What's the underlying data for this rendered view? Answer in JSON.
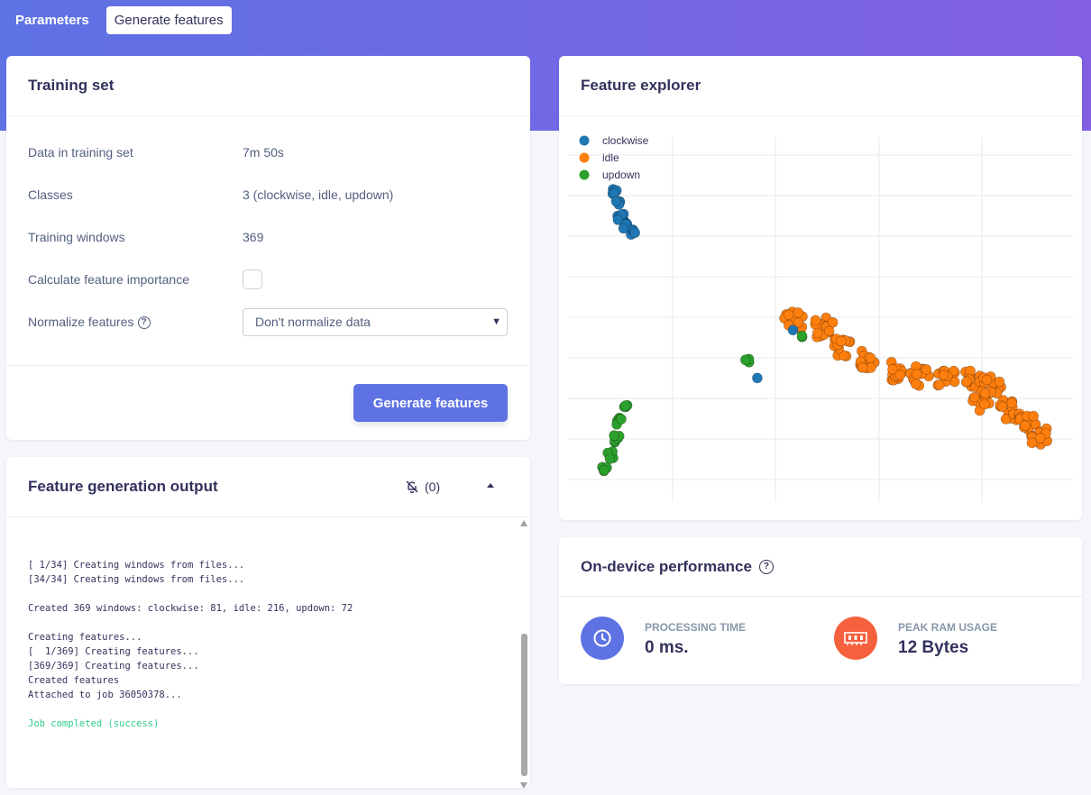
{
  "tabs": [
    {
      "label": "Parameters",
      "active": false
    },
    {
      "label": "Generate features",
      "active": true
    }
  ],
  "training_set": {
    "title": "Training set",
    "rows": [
      {
        "label": "Data in training set",
        "value": "7m 50s"
      },
      {
        "label": "Classes",
        "value": "3 (clockwise, idle, updown)"
      },
      {
        "label": "Training windows",
        "value": "369"
      },
      {
        "label": "Calculate feature importance",
        "checked": false
      },
      {
        "label": "Normalize features",
        "selected": "Don't normalize data"
      }
    ],
    "button": "Generate features"
  },
  "output": {
    "title": "Feature generation output",
    "notifications": "(0)",
    "log_lines": [
      "[ 1/34] Creating windows from files...",
      "[34/34] Creating windows from files...",
      "",
      "Created 369 windows: clockwise: 81, idle: 216, updown: 72",
      "",
      "Creating features...",
      "[  1/369] Creating features...",
      "[369/369] Creating features...",
      "Created features",
      "Attached to job 36050378...",
      ""
    ],
    "success_line": "Job completed (success)"
  },
  "explorer": {
    "title": "Feature explorer",
    "legend": [
      {
        "name": "clockwise",
        "color": "#1f77b4"
      },
      {
        "name": "idle",
        "color": "#ff7f0e"
      },
      {
        "name": "updown",
        "color": "#2ca02c"
      }
    ]
  },
  "performance": {
    "title": "On-device performance",
    "processing_label": "PROCESSING TIME",
    "processing_value": "0 ms.",
    "ram_label": "PEAK RAM USAGE",
    "ram_value": "12 Bytes",
    "colors": {
      "processing": "#5e72e4",
      "ram": "#f5603d"
    }
  }
}
